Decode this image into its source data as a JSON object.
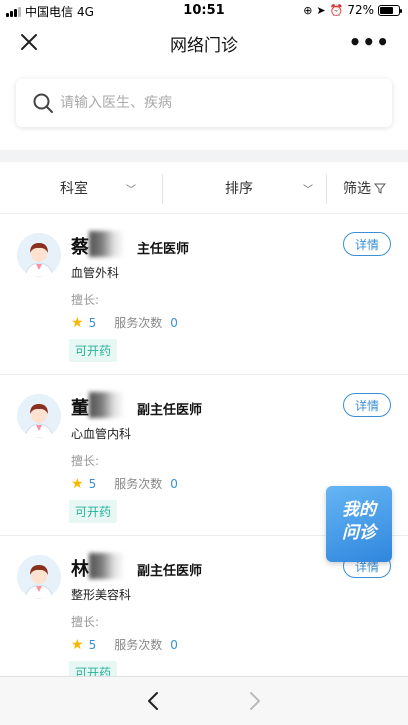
{
  "status_bar": {
    "carrier": "中国电信",
    "network": "4G",
    "time": "10:51",
    "battery": "72%"
  },
  "navbar": {
    "title": "网络门诊",
    "more": "•••"
  },
  "search": {
    "placeholder": "请输入医生、疾病"
  },
  "filters": {
    "department": "科室",
    "sort": "排序",
    "filter": "筛选"
  },
  "doctors": [
    {
      "name": "蔡",
      "title": "主任医师",
      "department": "血管外科",
      "specialty_label": "擅长:",
      "rating": "5",
      "service_label": "服务次数",
      "service_count": "0",
      "rx_badge": "可开药",
      "detail_label": "详情"
    },
    {
      "name": "董",
      "title": "副主任医师",
      "department": "心血管内科",
      "specialty_label": "擅长:",
      "rating": "5",
      "service_label": "服务次数",
      "service_count": "0",
      "rx_badge": "可开药",
      "detail_label": "详情"
    },
    {
      "name": "林",
      "title": "副主任医师",
      "department": "整形美容科",
      "specialty_label": "擅长:",
      "rating": "5",
      "service_label": "服务次数",
      "service_count": "0",
      "rx_badge": "可开药",
      "detail_label": "详情"
    }
  ],
  "floating": {
    "line1": "我的",
    "line2": "问诊"
  },
  "icons": {
    "close": "close-icon",
    "search": "search-icon",
    "back": "chevron-left-icon",
    "forward": "chevron-right-icon",
    "star": "star-icon"
  },
  "colors": {
    "accent": "#3a8fd6",
    "badge_text": "#26b39a",
    "badge_bg": "#e7f7f4",
    "star": "#f5b800"
  }
}
